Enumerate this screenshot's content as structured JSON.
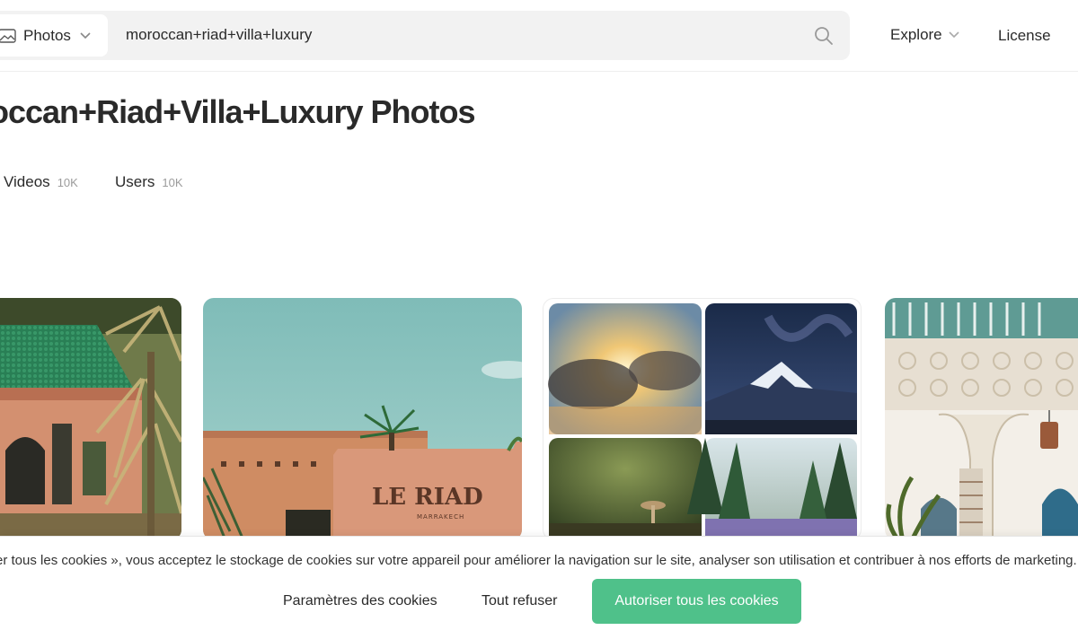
{
  "header": {
    "type_selector": "Photos",
    "query": "moroccan+riad+villa+luxury",
    "nav": {
      "explore": "Explore",
      "license": "License"
    }
  },
  "page_title": "occan+Riad+Villa+Luxury Photos",
  "tabs": [
    {
      "label": "Videos",
      "count": "10K"
    },
    {
      "label": "Users",
      "count": "10K"
    }
  ],
  "gallery": {
    "card2_sign_text": "LE RIAD",
    "card2_sign_subtext": "MARRAKECH"
  },
  "cookie_banner": {
    "text": "er tous les cookies », vous acceptez le stockage de cookies sur votre appareil pour améliorer la navigation sur le site, analyser son utilisation et contribuer à nos efforts de marketing.",
    "settings_label": "Paramètres des cookies",
    "refuse_label": "Tout refuser",
    "accept_label": "Autoriser tous les cookies"
  },
  "colors": {
    "accent_green": "#4fc18a",
    "text": "#2a2a2a",
    "muted": "#9b9b9b",
    "search_bg": "#f2f2f2"
  }
}
